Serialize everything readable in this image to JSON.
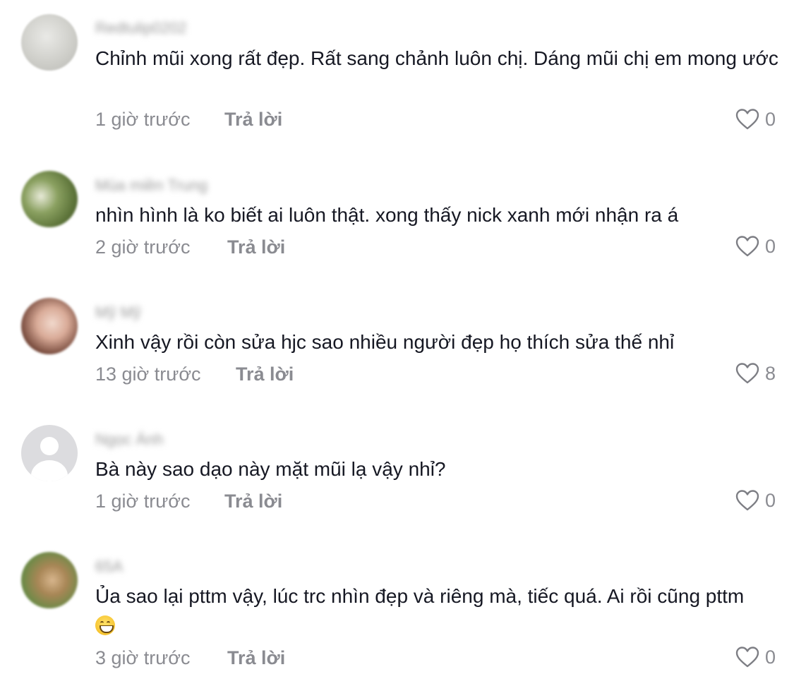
{
  "comments": [
    {
      "username": "Redtulip0202",
      "text": "Chỉnh mũi xong rất đẹp. Rất sang chảnh luôn chị. Dáng mũi chị em mong ước",
      "time": "1 giờ trước",
      "reply_label": "Trả lời",
      "likes": "0",
      "avatar_icon": "blurred-photo-avatar"
    },
    {
      "username": "Mùa miền Trung",
      "text": "nhìn hình là ko biết ai luôn thật. xong thấy nick xanh mới nhận ra á",
      "time": "2 giờ trước",
      "reply_label": "Trả lời",
      "likes": "0",
      "avatar_icon": "blurred-photo-avatar"
    },
    {
      "username": "Mỹ Mỹ",
      "text": "Xinh vậy rồi còn sửa hjc sao nhiều người đẹp họ thích sửa thế nhỉ",
      "time": "13 giờ trước",
      "reply_label": "Trả lời",
      "likes": "8",
      "avatar_icon": "blurred-photo-avatar"
    },
    {
      "username": "Ngọc Ánh",
      "text": "Bà này sao dạo này mặt mũi lạ vậy nhỉ?",
      "time": "1 giờ trước",
      "reply_label": "Trả lời",
      "likes": "0",
      "avatar_icon": "default-user-avatar"
    },
    {
      "username": "65A",
      "text": "Ủa sao lại pttm vậy, lúc trc nhìn đẹp và riêng mà, tiếc quá. Ai rồi cũng pttm",
      "time": "3 giờ trước",
      "reply_label": "Trả lời",
      "likes": "0",
      "avatar_icon": "blurred-photo-avatar",
      "emoji": "grinning-face-emoji"
    }
  ],
  "colors": {
    "text": "#161823",
    "meta": "#8a8b91",
    "background": "#ffffff"
  }
}
